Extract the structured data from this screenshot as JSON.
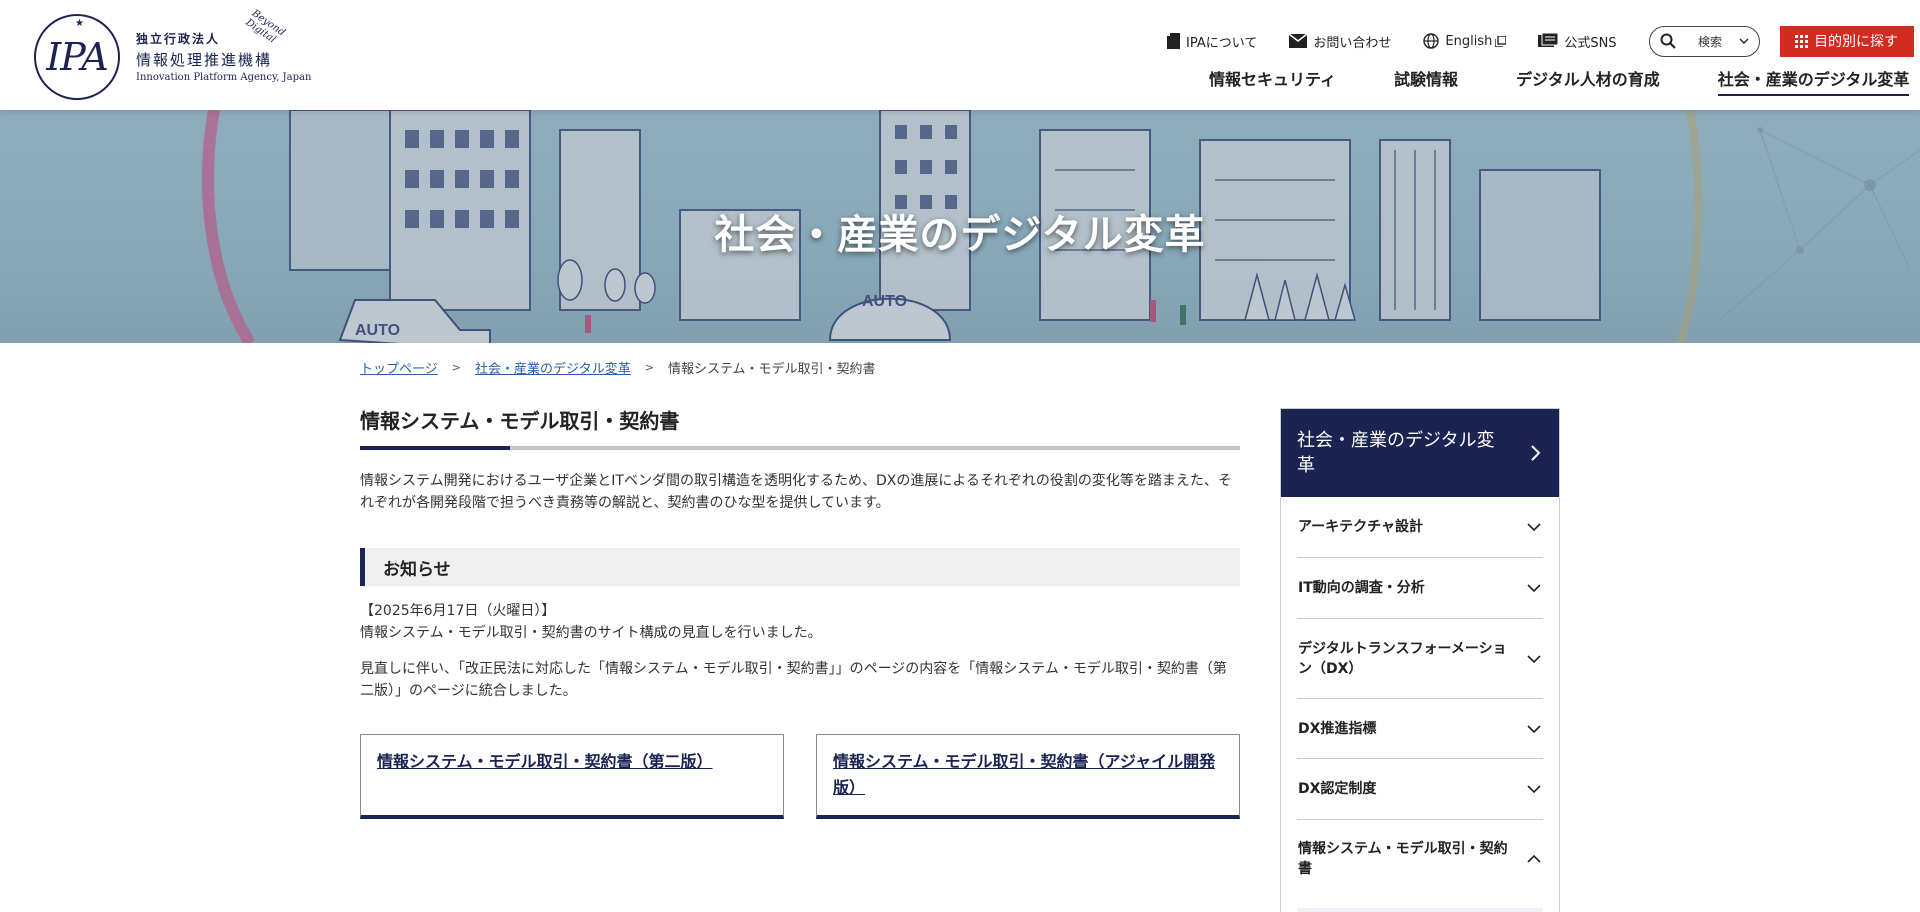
{
  "header": {
    "logo": {
      "mark": "IPA",
      "line1": "独立行政法人",
      "line2": "情報処理推進機構",
      "line3": "Innovation Platform Agency, Japan",
      "tagline": "Beyond Digital"
    },
    "util_nav": {
      "about": "IPAについて",
      "contact": "お問い合わせ",
      "english": "English",
      "sns": "公式SNS",
      "search": "検索",
      "purpose": "目的別に探す"
    },
    "main_nav": [
      {
        "label": "情報セキュリティ"
      },
      {
        "label": "試験情報"
      },
      {
        "label": "デジタル人材の育成"
      },
      {
        "label": "社会・産業のデジタル変革"
      }
    ]
  },
  "hero": {
    "title": "社会・産業のデジタル変革",
    "signs": [
      "AUTO",
      "AUTO"
    ]
  },
  "breadcrumb": {
    "items": [
      "トップページ",
      "社会・産業のデジタル変革"
    ],
    "current": "情報システム・モデル取引・契約書"
  },
  "main": {
    "title": "情報システム・モデル取引・契約書",
    "lead": "情報システム開発におけるユーザ企業とITベンダ間の取引構造を透明化するため、DXの進展によるそれぞれの役割の変化等を踏まえた、それぞれが各開発段階で担うべき責務等の解説と、契約書のひな型を提供しています。",
    "notice_heading": "お知らせ",
    "notice_date": "【2025年6月17日（火曜日）】",
    "notice_line1": "情報システム・モデル取引・契約書のサイト構成の見直しを行いました。",
    "notice_line2": "見直しに伴い、「改正民法に対応した「情報システム・モデル取引・契約書」」のページの内容を「情報システム・モデル取引・契約書（第二版）」のページに統合しました。",
    "cards": [
      {
        "label": "情報システム・モデル取引・契約書（第二版）"
      },
      {
        "label": "情報システム・モデル取引・契約書（アジャイル開発版）"
      }
    ]
  },
  "sidebar": {
    "heading": "社会・産業のデジタル変革",
    "items": [
      {
        "label": "アーキテクチャ設計",
        "expanded": false
      },
      {
        "label": "IT動向の調査・分析",
        "expanded": false
      },
      {
        "label": "デジタルトランスフォーメーション（DX）",
        "expanded": false
      },
      {
        "label": "DX推進指標",
        "expanded": false
      },
      {
        "label": "DX認定制度",
        "expanded": false
      },
      {
        "label": "情報システム・モデル取引・契約書",
        "expanded": true
      }
    ]
  },
  "colors": {
    "brand_navy": "#1b2352",
    "accent_red": "#d22b20",
    "link_blue": "#2c5ea8"
  }
}
